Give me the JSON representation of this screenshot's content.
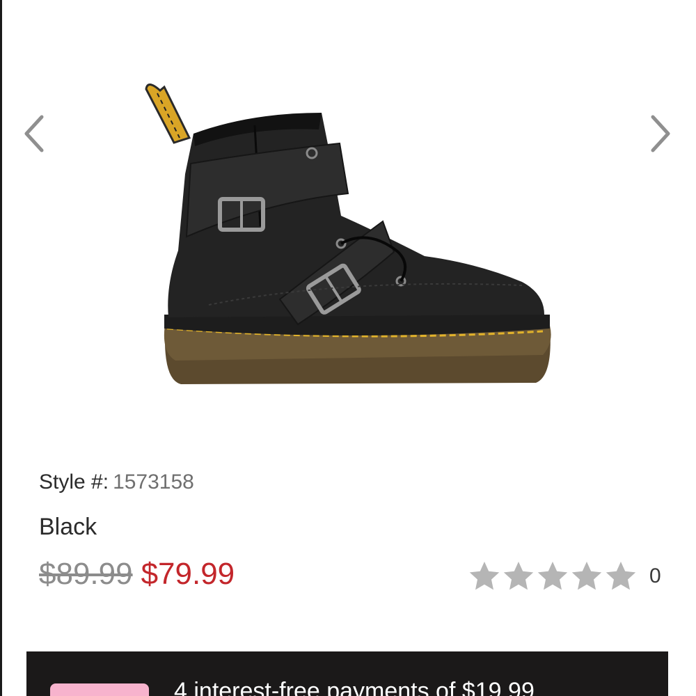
{
  "gallery": {
    "prev_icon": "chevron-left-icon",
    "next_icon": "chevron-right-icon",
    "image_subject": "black leather boot with two buckle straps"
  },
  "product": {
    "style_label": "Style #:",
    "style_number": "1573158",
    "color": "Black",
    "original_price": "$89.99",
    "sale_price": "$79.99",
    "review_count": "0"
  },
  "rating": {
    "stars_filled": 0,
    "stars_total": 5
  },
  "payment_banner": {
    "text": "4 interest-free payments of $19.99"
  },
  "colors": {
    "sale_price": "#c3262b",
    "original_price": "#8c8c8c",
    "star": "#b5b5b5",
    "banner_bg": "#1b1919",
    "badge_pink": "#f7b3cd"
  }
}
